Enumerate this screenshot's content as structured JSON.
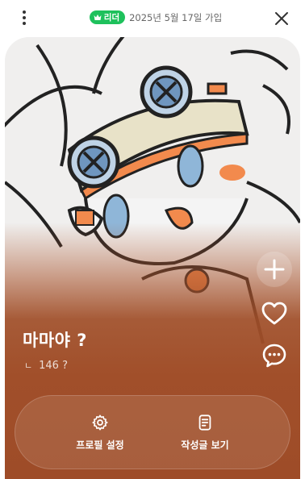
{
  "header": {
    "badge_label": "리더",
    "joined_text": "2025년 5월 17일 가입",
    "menu_icon": "more-vertical-icon",
    "close_icon": "close-icon"
  },
  "profile": {
    "name": "마마야 ?",
    "follow_count": "146 ?",
    "follow_prefix": "ㄴ"
  },
  "side_actions": [
    {
      "icon": "plus-icon"
    },
    {
      "icon": "heart-icon"
    },
    {
      "icon": "chat-icon"
    }
  ],
  "bottom_actions": {
    "settings_label": "프로필 설정",
    "posts_label": "작성글 보기"
  },
  "colors": {
    "accent": "#1ec15c",
    "card_bottom": "#a14f2a"
  }
}
